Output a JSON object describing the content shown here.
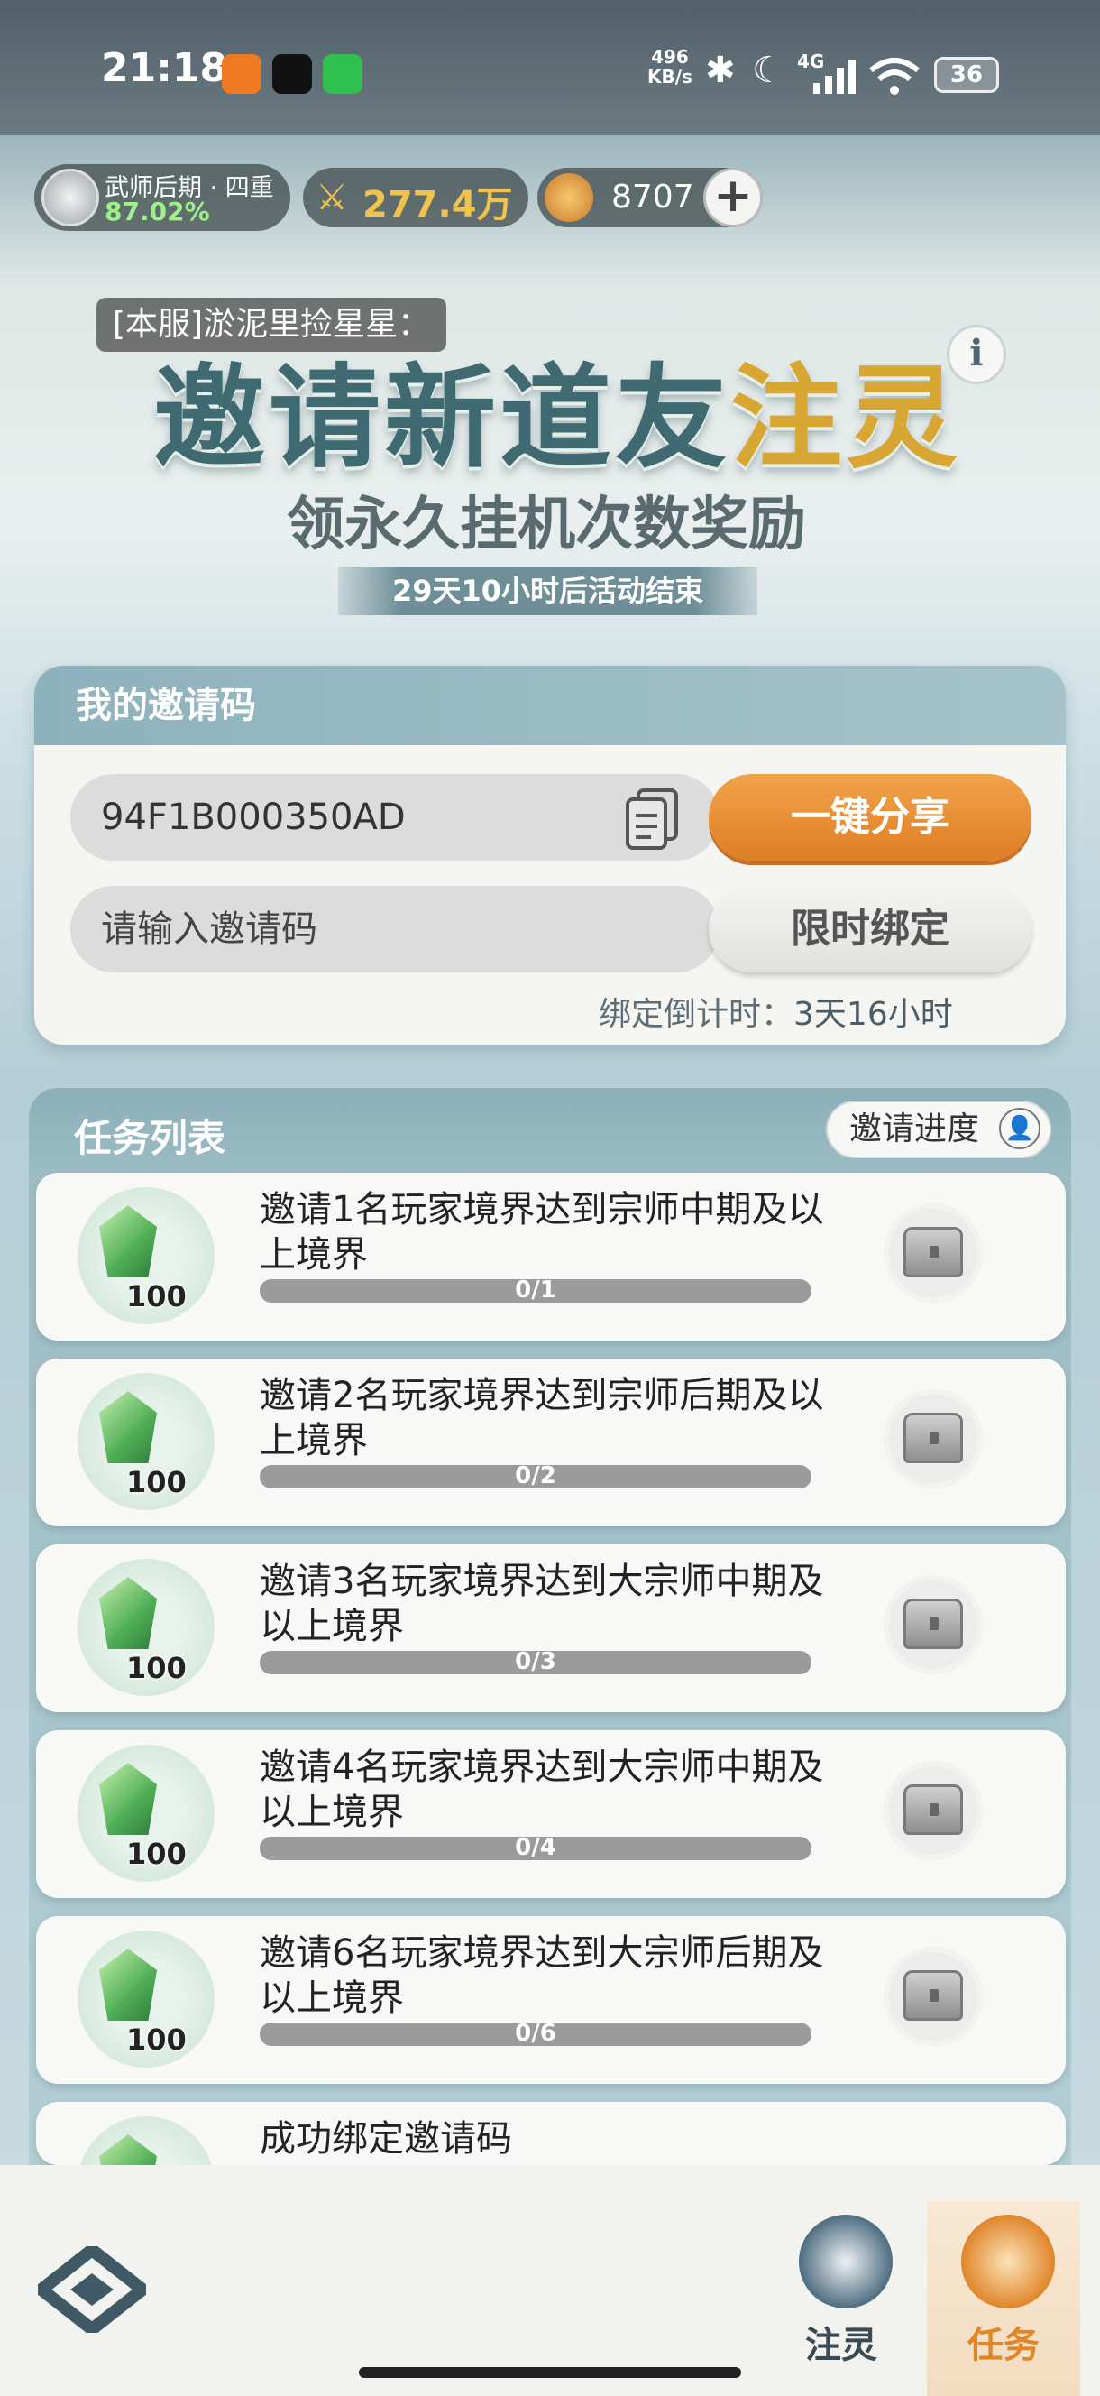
{
  "status_bar": {
    "time": "21:18",
    "net_speed_top": "496",
    "net_speed_unit": "KB/s",
    "signal": "4G",
    "battery": "36"
  },
  "player": {
    "realm": "武师后期 · 四重",
    "percent": "87.02%"
  },
  "currency": {
    "power": "277.4万",
    "coins": "8707",
    "add": "+"
  },
  "toast": "[本服]淤泥里捡星星：",
  "event": {
    "title_part1": "邀请新道友",
    "title_part2": "注灵",
    "subtitle": "领永久挂机次数奖励",
    "time_left": "29天10小时后活动结束",
    "info": "i"
  },
  "invite": {
    "header": "我的邀请码",
    "code": "94F1B000350AD",
    "share_button": "一键分享",
    "input_placeholder": "请输入邀请码",
    "bind_button": "限时绑定",
    "countdown_label": "绑定倒计时：",
    "countdown_value": "3天16小时"
  },
  "tasks": {
    "title": "任务列表",
    "progress_button": "邀请进度",
    "items": [
      {
        "text": "邀请1名玩家境界达到宗师中期及以上境界",
        "qty": "100",
        "progress": "0/1",
        "fraction": 0
      },
      {
        "text": "邀请2名玩家境界达到宗师后期及以上境界",
        "qty": "100",
        "progress": "0/2",
        "fraction": 0
      },
      {
        "text": "邀请3名玩家境界达到大宗师中期及以上境界",
        "qty": "100",
        "progress": "0/3",
        "fraction": 0
      },
      {
        "text": "邀请4名玩家境界达到大宗师中期及以上境界",
        "qty": "100",
        "progress": "0/4",
        "fraction": 0
      },
      {
        "text": "邀请6名玩家境界达到大宗师后期及以上境界",
        "qty": "100",
        "progress": "0/6",
        "fraction": 0
      },
      {
        "text": "成功绑定邀请码",
        "qty": "",
        "progress": "",
        "fraction": 0
      }
    ]
  },
  "nav": {
    "left": "注灵",
    "right": "任务"
  },
  "colors": {
    "accent": "#e0862a",
    "title": "#3f6a72",
    "nav_active": "#e0862a"
  }
}
